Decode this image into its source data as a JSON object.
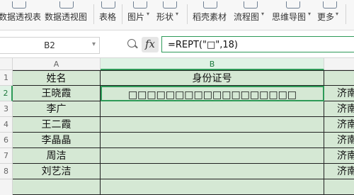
{
  "ribbon": {
    "items": [
      {
        "label": "数据透视表",
        "arrow": ""
      },
      {
        "label": "数据透视图",
        "arrow": ""
      },
      {
        "label": "表格",
        "arrow": ""
      },
      {
        "label": "图片",
        "arrow": "▾"
      },
      {
        "label": "形状",
        "arrow": "▾"
      },
      {
        "label": "稻壳素材",
        "arrow": ""
      },
      {
        "label": "流程图",
        "arrow": "▾"
      },
      {
        "label": "思维导图",
        "arrow": "▾"
      },
      {
        "label": "更多",
        "arrow": "▾"
      }
    ]
  },
  "formula_bar": {
    "cell_ref": "B2",
    "fx_label": "fx",
    "formula": "=REPT(\"□\",18)"
  },
  "columns": [
    "A",
    "B"
  ],
  "rows": [
    {
      "num": "1",
      "a": "姓名",
      "b": "身份证号",
      "c": ""
    },
    {
      "num": "2",
      "a": "王晓霞",
      "b": "□□□□□□□□□□□□□□□□□□",
      "c": "济南"
    },
    {
      "num": "3",
      "a": "李广",
      "b": "",
      "c": "济南"
    },
    {
      "num": "4",
      "a": "王二霞",
      "b": "",
      "c": "济南"
    },
    {
      "num": "6",
      "a": "李晶晶",
      "b": "",
      "c": "济南"
    },
    {
      "num": "7",
      "a": "周洁",
      "b": "",
      "c": "济南"
    },
    {
      "num": "8",
      "a": "刘艺洁",
      "b": "",
      "c": "济南"
    }
  ],
  "colors": {
    "cell_fill": "#d5e8d4",
    "selection": "#2e9a58"
  }
}
